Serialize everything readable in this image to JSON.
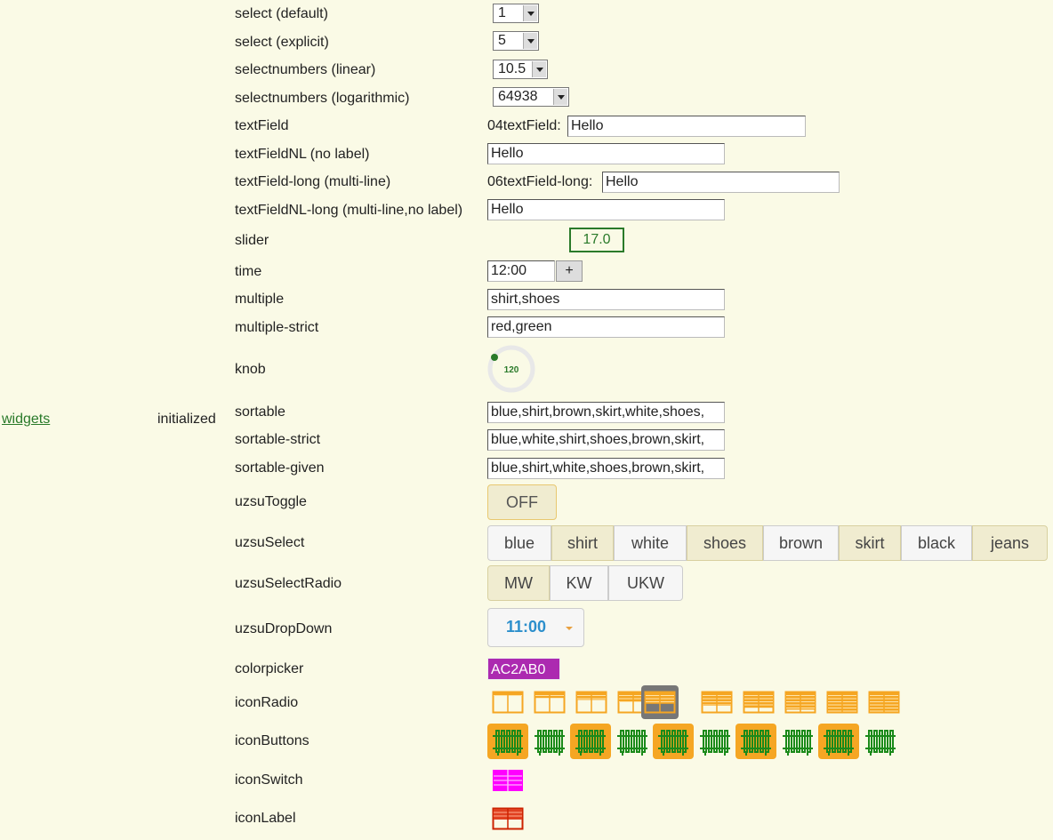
{
  "side": {
    "link": "widgets",
    "status": "initialized"
  },
  "rows": {
    "select_default": {
      "label": "select (default)",
      "value": "1"
    },
    "select_explicit": {
      "label": "select (explicit)",
      "value": "5"
    },
    "selectnumbers_linear": {
      "label": "selectnumbers (linear)",
      "value": "10.5"
    },
    "selectnumbers_log": {
      "label": "selectnumbers (logarithmic)",
      "value": "64938"
    },
    "textfield": {
      "label": "textField",
      "prefix": "04textField:",
      "value": "Hello"
    },
    "textfieldnl": {
      "label": "textFieldNL (no label)",
      "value": "Hello"
    },
    "textfield_long": {
      "label": "textField-long (multi-line)",
      "prefix": "06textField-long:",
      "value": "Hello"
    },
    "textfieldnl_long": {
      "label": "textFieldNL-long (multi-line,no label)",
      "value": "Hello"
    },
    "slider": {
      "label": "slider",
      "value": "17.0"
    },
    "time": {
      "label": "time",
      "value": "12:00",
      "button": "+"
    },
    "multiple": {
      "label": "multiple",
      "value": "shirt,shoes"
    },
    "multiple_strict": {
      "label": "multiple-strict",
      "value": "red,green"
    },
    "knob": {
      "label": "knob",
      "value": "120"
    },
    "sortable": {
      "label": "sortable",
      "value": "blue,shirt,brown,skirt,white,shoes,"
    },
    "sortable_strict": {
      "label": "sortable-strict",
      "value": "blue,white,shirt,shoes,brown,skirt,"
    },
    "sortable_given": {
      "label": "sortable-given",
      "value": "blue,shirt,white,shoes,brown,skirt,"
    },
    "uzsutoggle": {
      "label": "uzsuToggle",
      "value": "OFF"
    },
    "uzsuselect": {
      "label": "uzsuSelect",
      "options": [
        "blue",
        "shirt",
        "white",
        "shoes",
        "brown",
        "skirt",
        "black",
        "jeans"
      ]
    },
    "uzsuselectradio": {
      "label": "uzsuSelectRadio",
      "options": [
        "MW",
        "KW",
        "UKW"
      ]
    },
    "uzsudropdown": {
      "label": "uzsuDropDown",
      "value": "11:00"
    },
    "colorpicker": {
      "label": "colorpicker",
      "value": "AC2AB0",
      "color": "#ac2ab0"
    },
    "iconradio": {
      "label": "iconRadio",
      "icon": "window-shutter-icon",
      "count": 10,
      "selected": 4,
      "color": "#f5a623"
    },
    "iconbuttons": {
      "label": "iconButtons",
      "icon": "radiator-icon",
      "count": 10,
      "color": "#1a8a1a",
      "highlight": "#f5a623"
    },
    "iconswitch": {
      "label": "iconSwitch",
      "icon": "shutter-icon",
      "color": "#ff00ff"
    },
    "iconlabel": {
      "label": "iconLabel",
      "icon": "shutter-icon",
      "color": "#cc2200"
    }
  }
}
